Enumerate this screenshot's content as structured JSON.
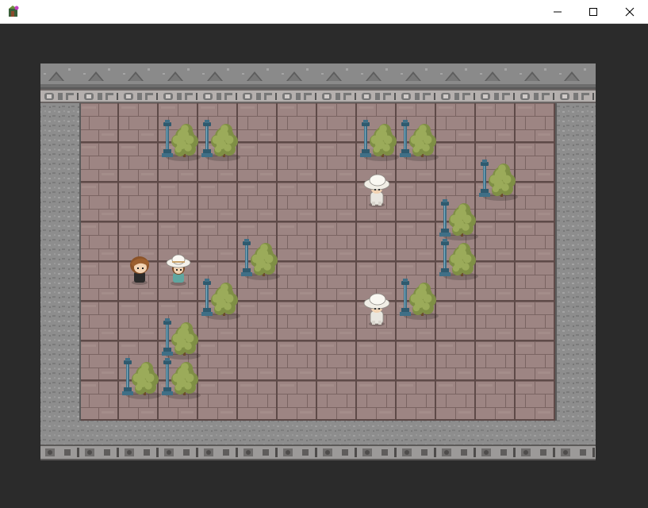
{
  "window": {
    "title": "",
    "icon": "game-app-icon",
    "controls": [
      "minimize-icon",
      "maximize-icon",
      "close-icon"
    ]
  },
  "scene": {
    "floor": "brick-tiles",
    "walls": "gray-stone",
    "props": [
      "street-lamp-icon",
      "bush-tree-icon"
    ],
    "characters": [
      {
        "name": "player-brown-hair",
        "facing": "down"
      },
      {
        "name": "companion-white-hat",
        "facing": "down"
      },
      {
        "name": "npc-white-hat-1",
        "facing": "down"
      },
      {
        "name": "npc-white-hat-2",
        "facing": "down"
      }
    ]
  },
  "colors": {
    "backdrop": "#2b2b2b",
    "titlebar": "#ffffff",
    "brick": "#9d8583",
    "mortar": "#6e5a58",
    "stone": "#8f8f8f",
    "lamp": "#3f6f86",
    "foliage": "#9bab5a"
  }
}
